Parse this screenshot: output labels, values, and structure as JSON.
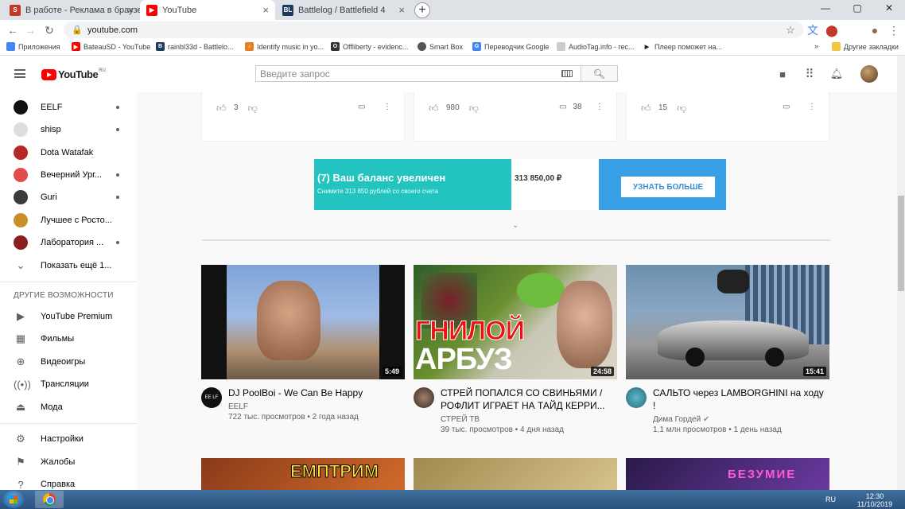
{
  "browser": {
    "tabs": [
      {
        "title": "В работе - Реклама в браузере"
      },
      {
        "title": "YouTube"
      },
      {
        "title": "Battlelog / Battlefield 4"
      }
    ],
    "url": "youtube.com",
    "bookmarks": [
      {
        "label": "Приложения"
      },
      {
        "label": "BateauSD - YouTube"
      },
      {
        "label": "rainbl33d - Battlelo..."
      },
      {
        "label": "Identify music in yo..."
      },
      {
        "label": "Offliberty - evidenc..."
      },
      {
        "label": "Smart Box"
      },
      {
        "label": "Переводчик Google"
      },
      {
        "label": "AudioTag.info - rec..."
      },
      {
        "label": "Плеер поможет на..."
      },
      {
        "label": "Другие закладки"
      }
    ],
    "more": "»"
  },
  "youtube": {
    "logo": "YouTube",
    "region": "RU",
    "search_placeholder": "Введите запрос"
  },
  "sidebar": {
    "subscriptions": [
      {
        "name": "EELF",
        "color": "#111111",
        "dot": true
      },
      {
        "name": "shisp",
        "color": "#dddddd",
        "dot": true
      },
      {
        "name": "Dota Watafak",
        "color": "#b8262a",
        "dot": false
      },
      {
        "name": "Вечерний Ург...",
        "color": "#e34b4b",
        "dot": true
      },
      {
        "name": "Guri",
        "color": "#3a3a3a",
        "dot": true
      },
      {
        "name": "Лучшее с Росто...",
        "color": "#c9902a",
        "dot": false
      },
      {
        "name": "Лаборатория ...",
        "color": "#8b1f1f",
        "dot": true
      }
    ],
    "show_more": "Показать ещё 1...",
    "other_heading": "ДРУГИЕ ВОЗМОЖНОСТИ",
    "other": [
      {
        "label": "YouTube Premium",
        "icon": "youtube-icon"
      },
      {
        "label": "Фильмы",
        "icon": "film-icon"
      },
      {
        "label": "Видеоигры",
        "icon": "gamepad-icon"
      },
      {
        "label": "Трансляции",
        "icon": "live-icon"
      },
      {
        "label": "Мода",
        "icon": "hanger-icon"
      }
    ],
    "settings": [
      {
        "label": "Настройки",
        "icon": "gear-icon"
      },
      {
        "label": "Жалобы",
        "icon": "flag-icon"
      },
      {
        "label": "Справка",
        "icon": "help-icon"
      }
    ]
  },
  "top_cards": [
    {
      "likes": "3"
    },
    {
      "likes": "980",
      "comments": "38"
    },
    {
      "likes": "15"
    }
  ],
  "ad": {
    "headline": "(7) Ваш баланс увеличен",
    "subline": "Снимите 313 850 рублей со своего счета",
    "amount": "313 850,00 ₽",
    "button": "УЗНАТЬ БОЛЬШЕ",
    "brand_color": "#23c3c0"
  },
  "videos": [
    {
      "title": "DJ PoolBoi - We Can Be Happy",
      "channel": "EELF",
      "meta": "722 тыс. просмотров • 2 года назад",
      "duration": "5:49"
    },
    {
      "title": "СТРЕЙ ПОПАЛСЯ СО СВИНЬЯМИ / РОФЛИТ ИГРАЕТ НА ТАЙД КЕРРИ...",
      "channel": "СТРЕЙ ТВ",
      "meta": "39 тыс. просмотров • 4 дня назад",
      "duration": "24:58",
      "thumb_text_1": "ГНИЛОЙ",
      "thumb_text_2": "АРБУЗ"
    },
    {
      "title": "САЛЬТО через LAMBORGHINI на ходу !",
      "channel": "Дима Гордей",
      "meta": "1,1 млн просмотров • 1 день назад",
      "duration": "15:41"
    }
  ],
  "bottom_thumbs": [
    {
      "text": "ЕМПТРИМ"
    },
    {
      "text": ""
    },
    {
      "text": "БЕЗУМИЕ"
    }
  ],
  "taskbar": {
    "lang": "RU",
    "time": "12:30",
    "date": "11/10/2019"
  }
}
